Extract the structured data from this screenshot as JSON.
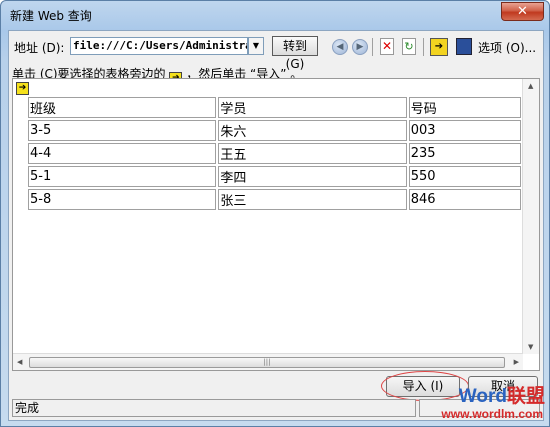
{
  "window": {
    "title": "新建 Web 查询",
    "close_label": "✕"
  },
  "toolbar": {
    "address_label": "地址 (D):",
    "address_value": "file:///C:/Users/Administrator/",
    "go_label": "转到 (G)",
    "options_label": "选项 (O)..."
  },
  "hint": {
    "prefix": "单击 (C)要选择的表格旁边的",
    "suffix": "，然后单击 “导入” 。"
  },
  "table": {
    "headers": [
      "班级",
      "学员",
      "号码"
    ],
    "rows": [
      [
        "3-5",
        "朱六",
        "003"
      ],
      [
        "4-4",
        "王五",
        "235"
      ],
      [
        "5-1",
        "李四",
        "550"
      ],
      [
        "5-8",
        "张三",
        "846"
      ]
    ]
  },
  "buttons": {
    "import": "导入 (I)",
    "cancel": "取消"
  },
  "status": {
    "text": "完成"
  },
  "watermark": {
    "word": "Word",
    "lm": "联盟",
    "url": "www.wordlm.com"
  },
  "icons": [
    "back-icon",
    "forward-icon",
    "stop-icon",
    "refresh-icon",
    "hide-icons-icon",
    "save-query-icon",
    "table-select-arrow-icon"
  ]
}
